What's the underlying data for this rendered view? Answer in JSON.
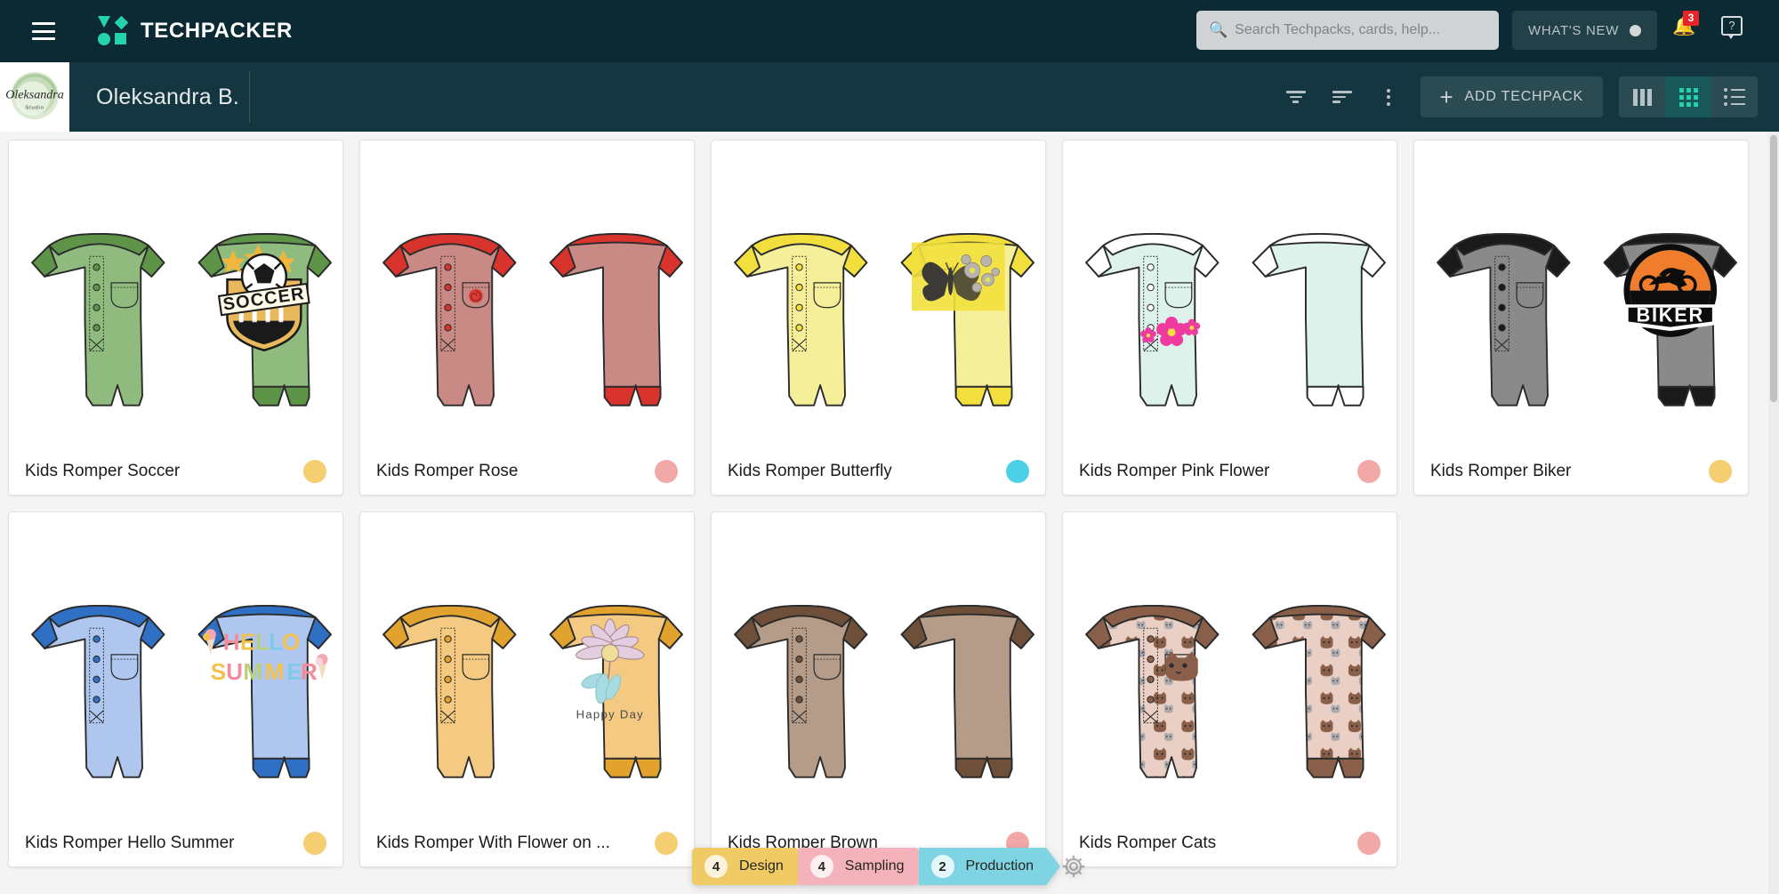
{
  "app": {
    "brand_name": "TECHPACKER",
    "menu_icon": "hamburger-icon",
    "logo_icon": "techpacker-logo-icon",
    "accent_color": "#25d3ab",
    "topbar_color": "#0b2a33",
    "subbar_color": "#143640"
  },
  "search": {
    "placeholder": "Search Techpacks, cards, help...",
    "value": "",
    "icon": "search-icon"
  },
  "whats_new": {
    "label": "WHAT'S NEW",
    "dot_color": "#d2d7d8"
  },
  "notifications": {
    "icon": "bell-icon",
    "count": "3",
    "badge_color": "#e4262b"
  },
  "help": {
    "icon": "help-question-icon",
    "label": "?"
  },
  "workspace": {
    "title": "Oleksandra B.",
    "avatar_icon": "oleksandra-studio-avatar",
    "avatar_text": "Oleksandra",
    "avatar_subtext": "Studio"
  },
  "toolbar": {
    "filter_icon": "filter-icon",
    "sort_icon": "sort-icon",
    "more_icon": "kebab-menu-icon",
    "add_label": "ADD TECHPACK",
    "add_plus": "+",
    "views": [
      {
        "name": "board-view",
        "icon": "columns-icon",
        "active": false
      },
      {
        "name": "grid-view",
        "icon": "grid-icon",
        "active": true
      },
      {
        "name": "list-view",
        "icon": "list-icon",
        "active": false
      }
    ]
  },
  "cards": [
    {
      "title": "Kids Romper Soccer",
      "dot_color": "#f6ce72",
      "body": "#8fbc7e",
      "trim": "#5d9448",
      "graphic": "soccer"
    },
    {
      "title": "Kids Romper Rose",
      "dot_color": "#f3a8a8",
      "body": "#c98a86",
      "trim": "#d8332c",
      "graphic": "rose"
    },
    {
      "title": "Kids Romper Butterfly",
      "dot_color": "#4cd0e8",
      "body": "#f6ef9a",
      "trim": "#f2df3e",
      "graphic": "butterfly"
    },
    {
      "title": "Kids Romper Pink Flower",
      "dot_color": "#f3a8a8",
      "body": "#dcf2ea",
      "trim": "#ffffff",
      "graphic": "pinkflower"
    },
    {
      "title": "Kids Romper Biker",
      "dot_color": "#f6ce72",
      "body": "#8a8a8a",
      "trim": "#1a1a1a",
      "graphic": "biker"
    },
    {
      "title": "Kids Romper Hello Summer",
      "dot_color": "#f6ce72",
      "body": "#afc6ef",
      "trim": "#2f6fc4",
      "graphic": "hellosummer"
    },
    {
      "title": "Kids Romper With Flower on ...",
      "dot_color": "#f6ce72",
      "body": "#f4c981",
      "trim": "#e2a22e",
      "graphic": "happyday"
    },
    {
      "title": "Kids Romper Brown",
      "dot_color": "#f3a8a8",
      "body": "#b49c88",
      "trim": "#6d4f3a",
      "graphic": "plain"
    },
    {
      "title": "Kids Romper Cats",
      "dot_color": "#f3a8a8",
      "body": "#e9cfc4",
      "trim": "#8a5f4a",
      "graphic": "cats"
    }
  ],
  "stages": [
    {
      "label": "Design",
      "count": "4",
      "color": "#f0ca64"
    },
    {
      "label": "Sampling",
      "count": "4",
      "color": "#f4b3bb"
    },
    {
      "label": "Production",
      "count": "2",
      "color": "#7ed4e2"
    }
  ],
  "stage_settings": {
    "icon": "gear-icon"
  },
  "scrollbar": {
    "name": "vertical-scrollbar"
  }
}
